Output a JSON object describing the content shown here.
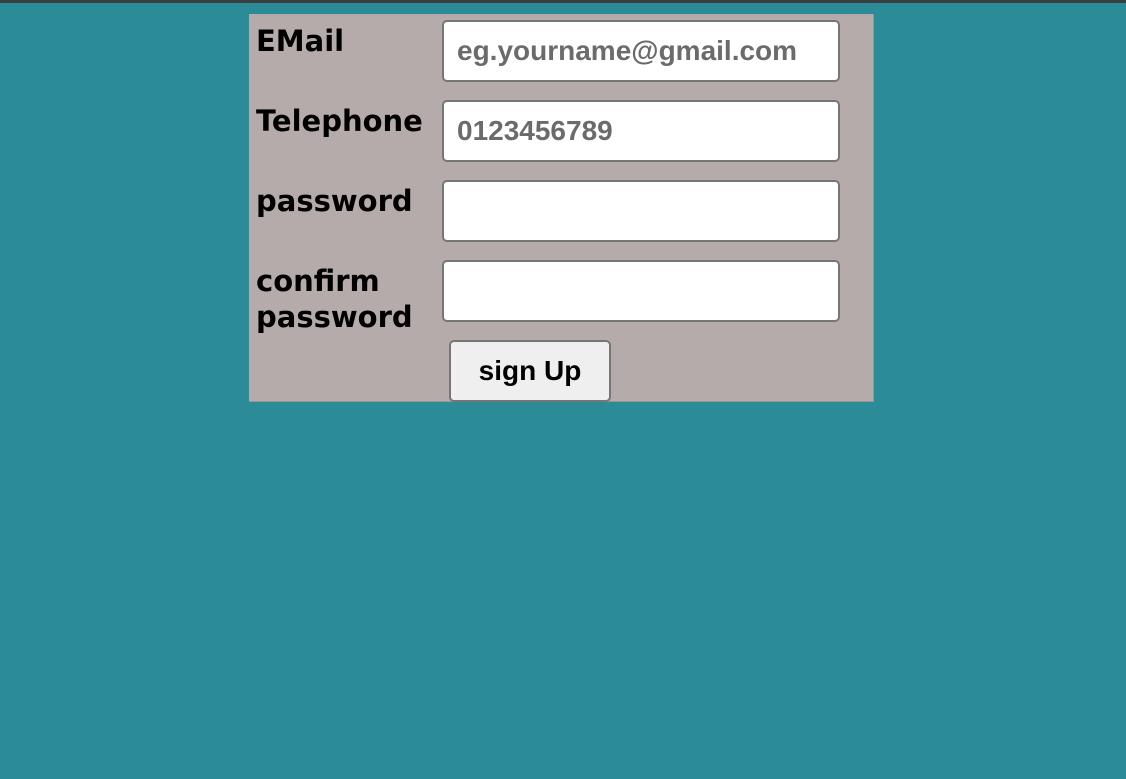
{
  "colors": {
    "page_background": "#2b8b97",
    "panel_background": "#b5abaa",
    "input_background": "#ffffff",
    "button_background": "#efefef"
  },
  "signup_form": {
    "email": {
      "label": "EMail",
      "value": "",
      "placeholder": "eg.yourname@gmail.com"
    },
    "telephone": {
      "label": "Telephone",
      "value": "",
      "placeholder": "0123456789"
    },
    "password": {
      "label": "password",
      "value": "",
      "placeholder": ""
    },
    "confirm_password": {
      "label": "confirm password",
      "value": "",
      "placeholder": ""
    },
    "submit_label": "sign Up"
  }
}
